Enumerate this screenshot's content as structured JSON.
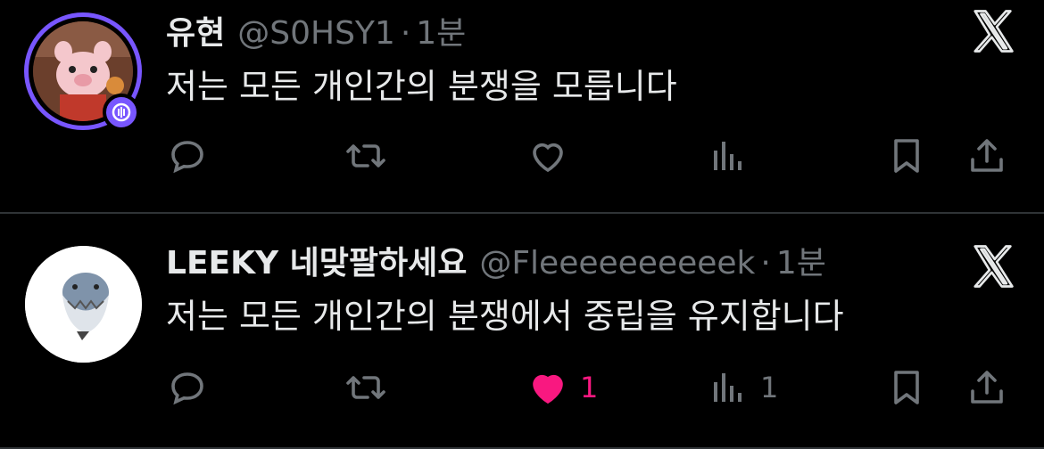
{
  "tweets": [
    {
      "name": "유현",
      "handle": "@S0HSY1",
      "separator": "·",
      "time": "1분",
      "text": "저는 모든 개인간의 분쟁을 모릅니다",
      "avatar_icon": "pig-character-avatar",
      "badge_icon": "podcast-badge-icon",
      "likes": "",
      "views": "",
      "liked": false
    },
    {
      "name": "LEEKY 네맞팔하세요",
      "handle": "@Fleeeeeeeeeek",
      "separator": "·",
      "time": "1분",
      "text": "저는 모든 개인간의 분쟁에서 중립을 유지합니다",
      "avatar_icon": "shark-character-avatar",
      "likes": "1",
      "views": "1",
      "liked": true
    }
  ],
  "colors": {
    "background": "#000000",
    "text": "#e7e9ea",
    "muted": "#71767b",
    "like_active": "#f91880",
    "ring": "#7856ff"
  }
}
